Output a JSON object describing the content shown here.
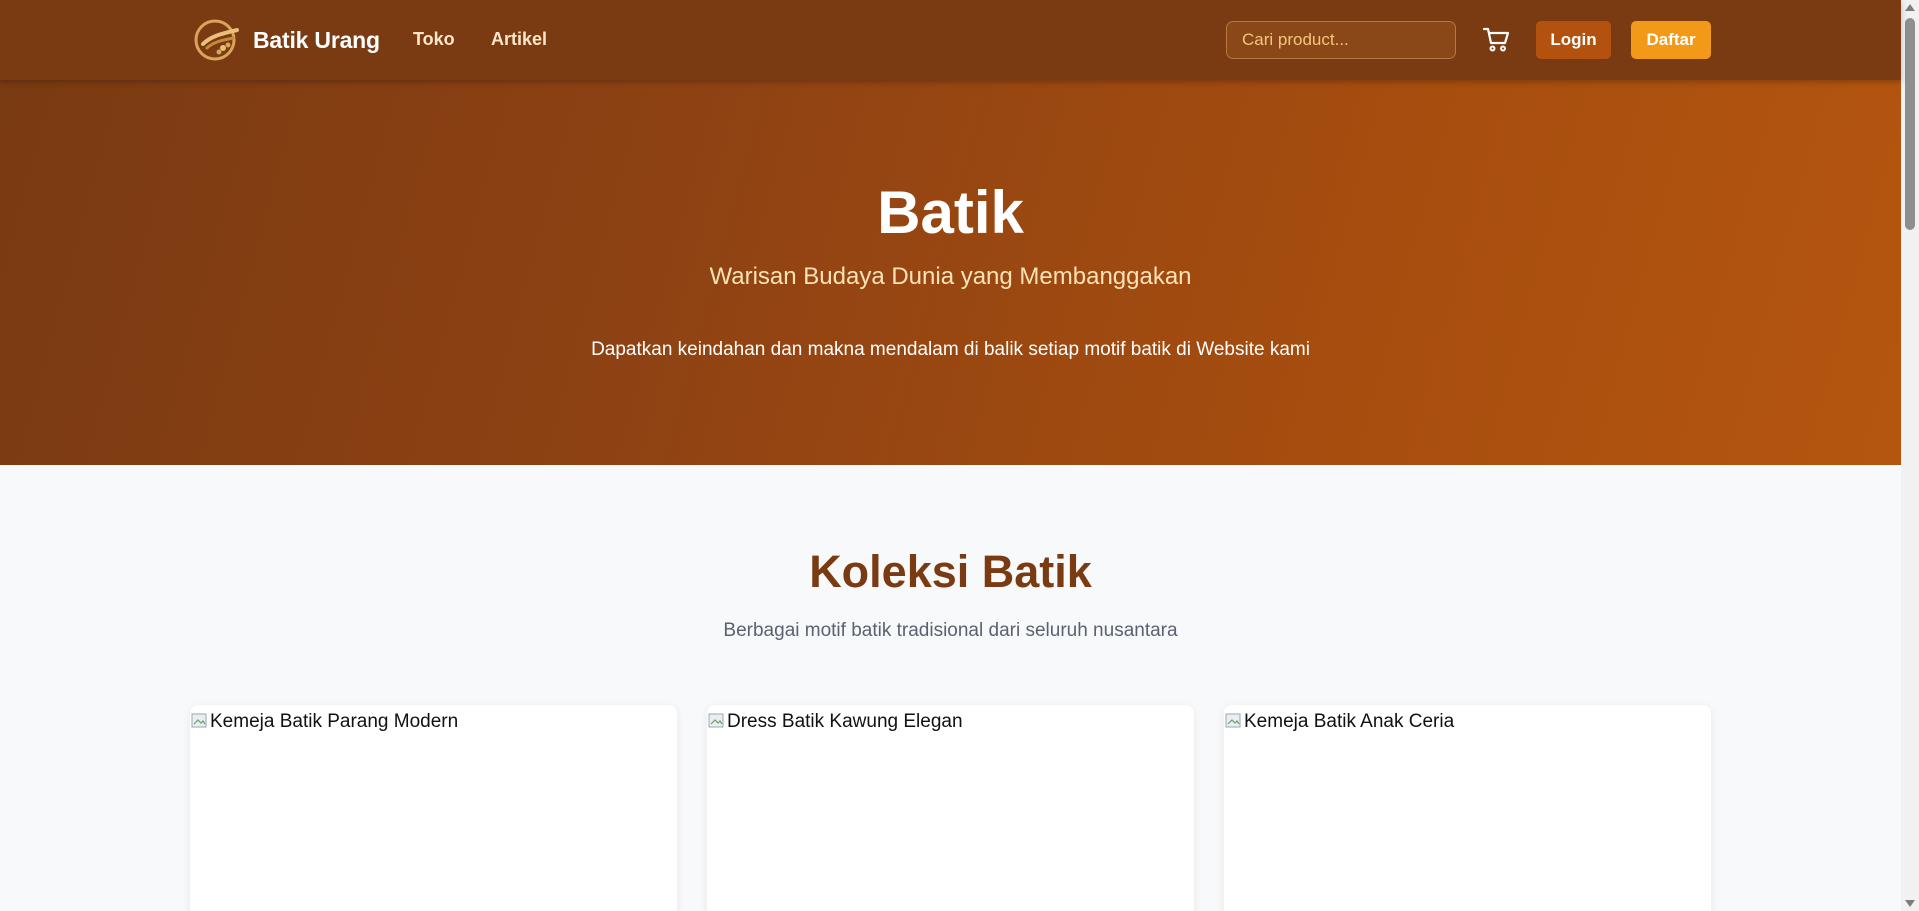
{
  "navbar": {
    "brand_name": "Batik Urang",
    "links": [
      {
        "label": "Toko"
      },
      {
        "label": "Artikel"
      }
    ],
    "search": {
      "placeholder": "Cari product...",
      "value": ""
    },
    "cart_icon": "shopping-cart-icon",
    "login_label": "Login",
    "register_label": "Daftar"
  },
  "hero": {
    "title": "Batik",
    "subtitle": "Warisan Budaya Dunia yang Membanggakan",
    "description": "Dapatkan keindahan dan makna mendalam di balik setiap motif batik di Website kami"
  },
  "collection": {
    "title": "Koleksi Batik",
    "subtitle": "Berbagai motif batik tradisional dari seluruh nusantara",
    "products": [
      {
        "image_alt": "Kemeja Batik Parang Modern"
      },
      {
        "image_alt": "Dress Batik Kawung Elegan"
      },
      {
        "image_alt": "Kemeja Batik Anak Ceria"
      }
    ]
  },
  "colors": {
    "navbar": "#7a3a12",
    "hero_start": "#7a3a12",
    "hero_end": "#b5560f",
    "login_button": "#b3520f",
    "register_button": "#f29a18",
    "section_title": "#7a3a12"
  }
}
